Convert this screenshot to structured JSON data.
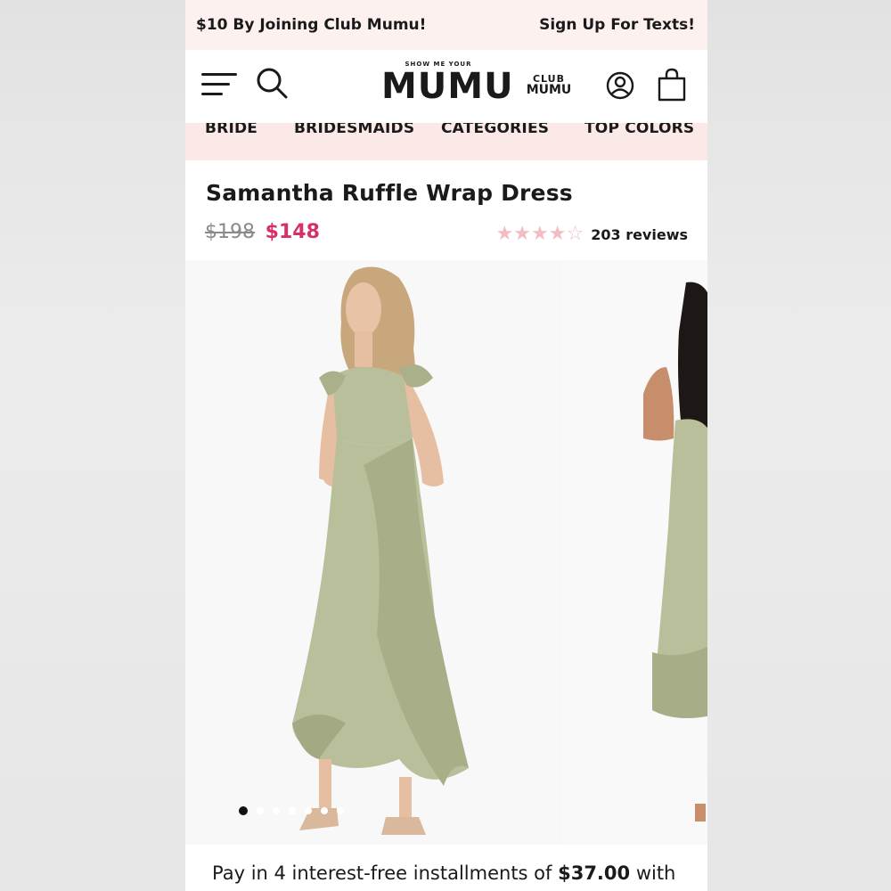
{
  "promo": {
    "left_text": "$10 By Joining Club Mumu!",
    "right_text": "Sign Up For Texts!"
  },
  "header": {
    "logo_small": "SHOW ME YOUR",
    "logo_main": "MUMU",
    "club_top": "CLUB",
    "club_bottom": "MUMU"
  },
  "nav": {
    "items": [
      "BRIDE",
      "BRIDESMAIDS",
      "CATEGORIES",
      "TOP COLORS"
    ]
  },
  "product": {
    "title": "Samantha Ruffle Wrap Dress",
    "old_price": "$198",
    "new_price": "$148",
    "rating": 4,
    "rating_max": 5,
    "reviews_label": "203 reviews"
  },
  "carousel": {
    "slide_count": 7,
    "active_index": 0
  },
  "payment": {
    "prefix": "Pay in 4 interest-free installments of ",
    "amount": "$37.00",
    "suffix": " with"
  },
  "colors": {
    "accent_price": "#d6306b",
    "promo_bg": "#fdf1ef",
    "nav_bg": "#fbe9e7",
    "star": "#f3bcc3",
    "dress": "#b9bf9a"
  }
}
